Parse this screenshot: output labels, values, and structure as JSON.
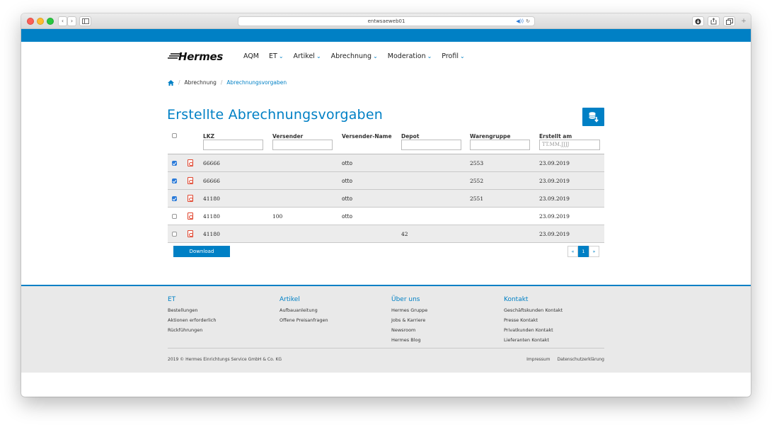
{
  "browser": {
    "address": "entwsaeweb01",
    "nav_back": "‹",
    "nav_forward": "›"
  },
  "header": {
    "logo": "Hermes",
    "nav": [
      {
        "label": "AQM",
        "has_dropdown": false
      },
      {
        "label": "ET",
        "has_dropdown": true
      },
      {
        "label": "Artikel",
        "has_dropdown": true
      },
      {
        "label": "Abrechnung",
        "has_dropdown": true
      },
      {
        "label": "Moderation",
        "has_dropdown": true
      },
      {
        "label": "Profil",
        "has_dropdown": true
      }
    ]
  },
  "breadcrumb": {
    "home_icon": "home-icon",
    "items": [
      "Abrechnung",
      "Abrechnungsvorgaben"
    ]
  },
  "page": {
    "title": "Erstellte Abrechnungsvorgaben",
    "export_icon": "export-database-icon"
  },
  "table": {
    "columns": [
      "LKZ",
      "Versender",
      "Versender-Name",
      "Depot",
      "Warengruppe",
      "Erstellt am"
    ],
    "date_placeholder": "TT.MM.JJJJ",
    "rows": [
      {
        "checked": true,
        "lkz": "66666",
        "versender": "",
        "name": "otto",
        "depot": "",
        "warengruppe": "2553",
        "erstellt": "23.09.2019"
      },
      {
        "checked": true,
        "lkz": "66666",
        "versender": "",
        "name": "otto",
        "depot": "",
        "warengruppe": "2552",
        "erstellt": "23.09.2019"
      },
      {
        "checked": true,
        "lkz": "41180",
        "versender": "",
        "name": "otto",
        "depot": "",
        "warengruppe": "2551",
        "erstellt": "23.09.2019"
      },
      {
        "checked": false,
        "lkz": "41180",
        "versender": "100",
        "name": "otto",
        "depot": "",
        "warengruppe": "",
        "erstellt": "23.09.2019"
      },
      {
        "checked": false,
        "lkz": "41180",
        "versender": "",
        "name": "",
        "depot": "42",
        "warengruppe": "",
        "erstellt": "23.09.2019"
      }
    ]
  },
  "actions": {
    "download": "Download"
  },
  "pagination": {
    "prev": "«",
    "current": "1",
    "next": "»"
  },
  "footer": {
    "columns": [
      {
        "title": "ET",
        "links": [
          "Bestellungen",
          "Aktionen erforderlich",
          "Rückführungen"
        ]
      },
      {
        "title": "Artikel",
        "links": [
          "Aufbauanleitung",
          "Offene Preisanfragen"
        ]
      },
      {
        "title": "Über uns",
        "links": [
          "Hermes Gruppe",
          "Jobs & Karriere",
          "Newsroom",
          "Hermes Blog"
        ]
      },
      {
        "title": "Kontakt",
        "links": [
          "Geschäftskunden Kontakt",
          "Presse Kontakt",
          "Privatkunden Kontakt",
          "Lieferanten Kontakt"
        ]
      }
    ],
    "copyright": "2019 © Hermes Einrichtungs Service GmbH & Co. KG",
    "legal": [
      "Impressum",
      "Datenschutzerklärung"
    ]
  },
  "colors": {
    "brand": "#0080c5",
    "row_shade": "#ececec",
    "checkbox": "#2a7ad8",
    "pdf": "#e0462f"
  }
}
